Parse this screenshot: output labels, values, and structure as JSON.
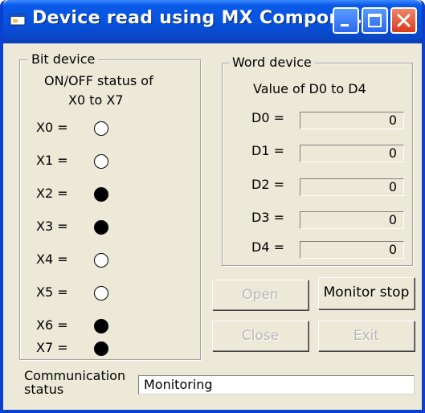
{
  "window": {
    "title": "Device read using MX Compon..."
  },
  "bit_device": {
    "group_title": "Bit device",
    "caption_line1": "ON/OFF status of",
    "caption_line2": "X0 to X7",
    "items": [
      {
        "label": "X0 =",
        "state": "off"
      },
      {
        "label": "X1 =",
        "state": "off"
      },
      {
        "label": "X2 =",
        "state": "on"
      },
      {
        "label": "X3 =",
        "state": "on"
      },
      {
        "label": "X4 =",
        "state": "off"
      },
      {
        "label": "X5 =",
        "state": "off"
      },
      {
        "label": "X6 =",
        "state": "on"
      },
      {
        "label": "X7 =",
        "state": "on"
      }
    ]
  },
  "word_device": {
    "group_title": "Word device",
    "caption": "Value of D0 to D4",
    "items": [
      {
        "label": "D0 =",
        "value": "0"
      },
      {
        "label": "D1 =",
        "value": "0"
      },
      {
        "label": "D2 =",
        "value": "0"
      },
      {
        "label": "D3 =",
        "value": "0"
      },
      {
        "label": "D4 =",
        "value": "0"
      }
    ]
  },
  "buttons": {
    "open": "Open",
    "monitor_stop": "Monitor stop",
    "close": "Close",
    "exit": "Exit"
  },
  "status": {
    "label_line1": "Communication",
    "label_line2": "status",
    "value": "Monitoring"
  },
  "colors": {
    "titlebar": "#0653de",
    "window_bg": "#ece9d8",
    "lamp_on": "#000000",
    "lamp_off": "#ffffff"
  }
}
